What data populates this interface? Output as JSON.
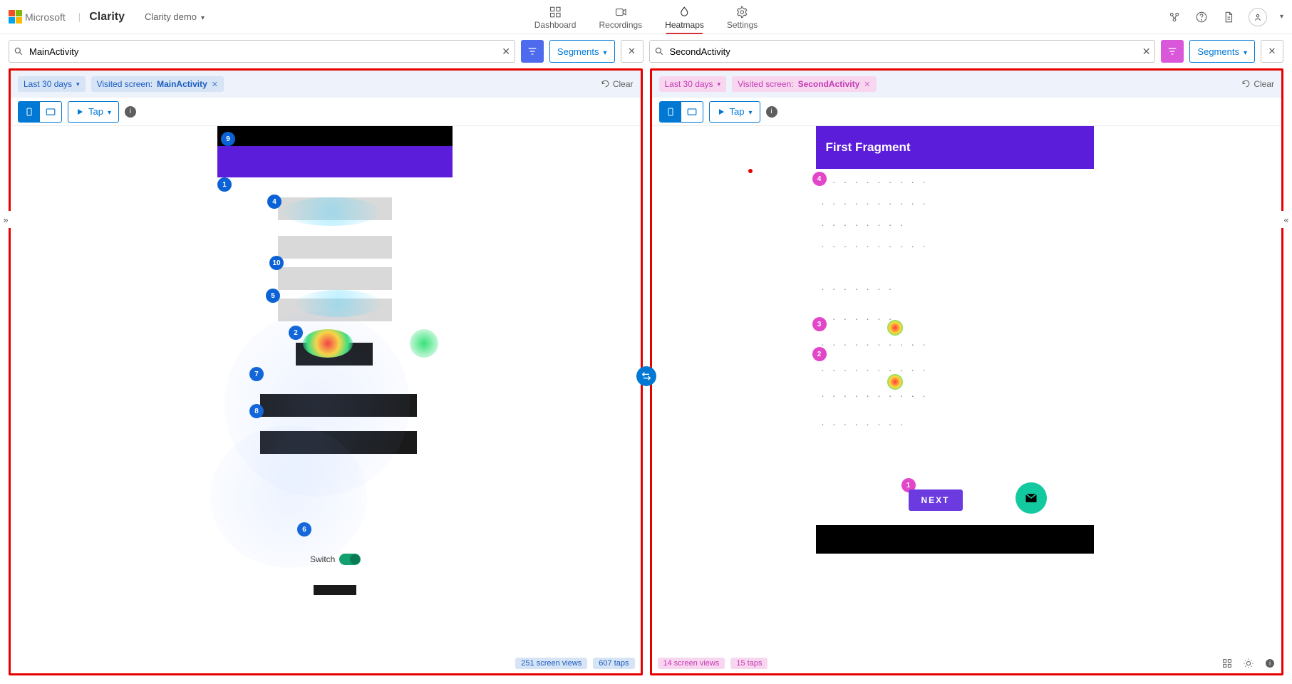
{
  "header": {
    "microsoft": "Microsoft",
    "brand": "Clarity",
    "project": "Clarity demo",
    "nav": {
      "dashboard": "Dashboard",
      "recordings": "Recordings",
      "heatmaps": "Heatmaps",
      "settings": "Settings"
    }
  },
  "filters": {
    "segments_label": "Segments"
  },
  "leftPane": {
    "search_value": "MainActivity",
    "tag_time": "Last 30 days",
    "tag_visited_prefix": "Visited screen: ",
    "tag_visited_value": "MainActivity",
    "clear": "Clear",
    "tap_label": "Tap",
    "footer_views": "251 screen views",
    "footer_taps": "607 taps",
    "switch_label": "Switch",
    "ranks": {
      "r1": "1",
      "r2": "2",
      "r4": "4",
      "r5": "5",
      "r6": "6",
      "r7": "7",
      "r8": "8",
      "r9": "9",
      "r10": "10"
    }
  },
  "rightPane": {
    "search_value": "SecondActivity",
    "tag_time": "Last 30 days",
    "tag_visited_prefix": "Visited screen: ",
    "tag_visited_value": "SecondActivity",
    "clear": "Clear",
    "tap_label": "Tap",
    "footer_views": "14 screen views",
    "footer_taps": "15 taps",
    "fragment_title": "First Fragment",
    "next_label": "NEXT",
    "ranks": {
      "r1": "1",
      "r2": "2",
      "r3": "3",
      "r4": "4"
    }
  }
}
